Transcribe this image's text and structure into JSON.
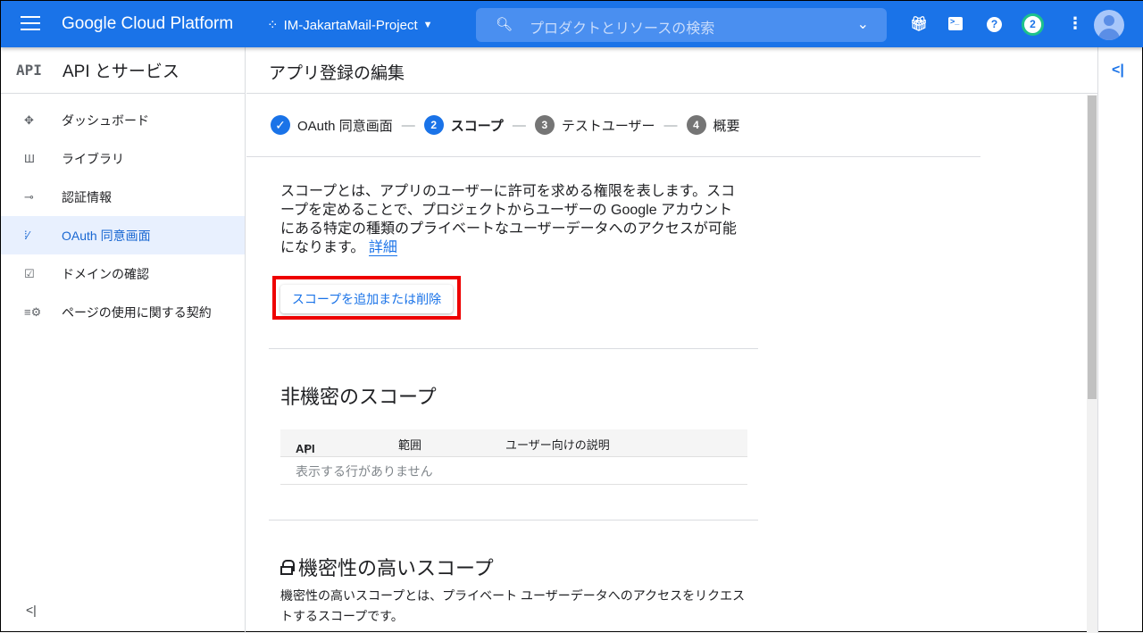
{
  "header": {
    "brand": "Google Cloud Platform",
    "project": "IM-JakartaMail-Project",
    "search_placeholder": "プロダクトとリソースの検索",
    "notification_count": "2"
  },
  "sidebar": {
    "title": "API とサービス",
    "api_icon": "API",
    "items": [
      {
        "label": "ダッシュボード",
        "icon": "dashboard-icon"
      },
      {
        "label": "ライブラリ",
        "icon": "library-icon"
      },
      {
        "label": "認証情報",
        "icon": "key-icon"
      },
      {
        "label": "OAuth 同意画面",
        "icon": "oauth-icon",
        "active": true
      },
      {
        "label": "ドメインの確認",
        "icon": "checkbox-icon"
      },
      {
        "label": "ページの使用に関する契約",
        "icon": "settings-list-icon"
      }
    ]
  },
  "main": {
    "title": "アプリ登録の編集",
    "steps": [
      {
        "num": "✓",
        "label": "OAuth 同意画面",
        "state": "done"
      },
      {
        "num": "2",
        "label": "スコープ",
        "state": "active"
      },
      {
        "num": "3",
        "label": "テストユーザー",
        "state": "pending"
      },
      {
        "num": "4",
        "label": "概要",
        "state": "pending"
      }
    ],
    "description": "スコープとは、アプリのユーザーに許可を求める権限を表します。スコープを定めることで、プロジェクトからユーザーの Google アカウントにある特定の種類のプライベートなユーザーデータへのアクセスが可能になります。",
    "details_link": "詳細",
    "add_scope_button": "スコープを追加または削除",
    "nonsensitive": {
      "heading": "非機密のスコープ",
      "columns": [
        "API",
        "範囲",
        "ユーザー向けの説明"
      ],
      "empty": "表示する行がありません"
    },
    "sensitive": {
      "heading": "機密性の高いスコープ",
      "description": "機密性の高いスコープとは、プライベート ユーザーデータへのアクセスをリクエストするスコープです。"
    }
  },
  "colors": {
    "primary": "#1a73e8",
    "highlight": "#e00000"
  }
}
